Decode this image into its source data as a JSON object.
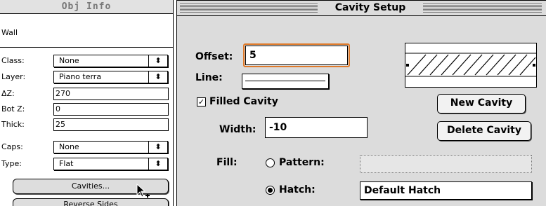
{
  "obj_info": {
    "title": "Obj Info",
    "object_type": "Wall",
    "class": {
      "label": "Class:",
      "value": "None"
    },
    "layer": {
      "label": "Layer:",
      "value": "Piano terra"
    },
    "delta_z": {
      "label": "ΔZ:",
      "value": "270"
    },
    "bot_z": {
      "label": "Bot Z:",
      "value": "0"
    },
    "thick": {
      "label": "Thick:",
      "value": "25"
    },
    "caps": {
      "label": "Caps:",
      "value": "None"
    },
    "type": {
      "label": "Type:",
      "value": "Flat"
    },
    "cavities_button": "Cavities...",
    "reverse_sides_button": "Reverse Sides",
    "popup_arrows": "⬍"
  },
  "cavity_setup": {
    "title": "Cavity Setup",
    "offset": {
      "label": "Offset:",
      "value": "5"
    },
    "line": {
      "label": "Line:"
    },
    "filled_cavity": {
      "label": "Filled Cavity",
      "checked": true,
      "mark": "✓"
    },
    "width": {
      "label": "Width:",
      "value": "-10"
    },
    "fill": {
      "label": "Fill:"
    },
    "pattern": {
      "label": "Pattern:",
      "selected": false
    },
    "hatch": {
      "label": "Hatch:",
      "selected": true,
      "value": "Default Hatch"
    },
    "new_cavity_button": "New Cavity",
    "delete_cavity_button": "Delete Cavity"
  },
  "colors": {
    "focus_ring": "#e07a2a",
    "dialog_bg": "#dcdcdc",
    "palette_title_bg": "#e2e2e2"
  }
}
